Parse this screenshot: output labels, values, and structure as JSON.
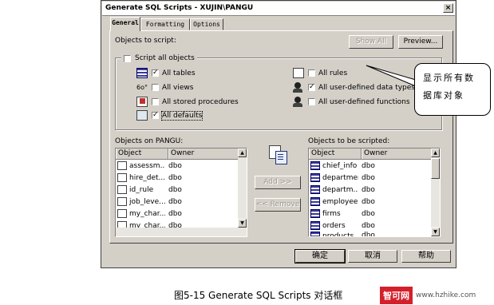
{
  "window": {
    "title": "Generate SQL Scripts - XUJIN\\PANGU",
    "close_label": "×"
  },
  "tabs": [
    {
      "label": "General"
    },
    {
      "label": "Formatting"
    },
    {
      "label": "Options"
    }
  ],
  "general": {
    "objects_to_script_label": "Objects to script:",
    "show_all_label": "Show All",
    "preview_label": "Preview...",
    "script_all_objects_label": "Script all objects",
    "options": [
      {
        "label": "All tables",
        "checked": true
      },
      {
        "label": "All views",
        "checked": false
      },
      {
        "label": "All stored procedures",
        "checked": false
      },
      {
        "label": "All defaults",
        "checked": true
      },
      {
        "label": "All rules",
        "checked": false
      },
      {
        "label": "All user-defined data types",
        "checked": true
      },
      {
        "label": "All user-defined functions",
        "checked": false
      }
    ],
    "objects_on_label": "Objects on PANGU:",
    "objects_to_be_scripted_label": "Objects to be scripted:",
    "columns": {
      "object": "Object",
      "owner": "Owner"
    },
    "left_list": [
      {
        "object": "assessm...",
        "owner": "dbo"
      },
      {
        "object": "hire_det...",
        "owner": "dbo"
      },
      {
        "object": "id_rule",
        "owner": "dbo"
      },
      {
        "object": "job_leve...",
        "owner": "dbo"
      },
      {
        "object": "my_char...",
        "owner": "dbo"
      },
      {
        "object": "my_char...",
        "owner": "dbo"
      }
    ],
    "right_list": [
      {
        "object": "chief_info",
        "owner": "dbo"
      },
      {
        "object": "department",
        "owner": "dbo"
      },
      {
        "object": "departm...",
        "owner": "dbo"
      },
      {
        "object": "employee",
        "owner": "dbo"
      },
      {
        "object": "firms",
        "owner": "dbo"
      },
      {
        "object": "orders",
        "owner": "dbo"
      },
      {
        "object": "products",
        "owner": "dbo"
      }
    ],
    "add_label": "Add >>",
    "remove_label": "<< Remove"
  },
  "footer": {
    "ok_label": "确定",
    "cancel_label": "取消",
    "help_label": "帮助"
  },
  "callout": {
    "line1": "显示所有数",
    "line2": "据库对象"
  },
  "caption": "图5-15  Generate SQL Scripts 对话框",
  "watermark": {
    "brand": "智可网",
    "url": "www.hzhike.com"
  },
  "colors": {
    "dialog_bg": "#d4d0c8",
    "table_icon": "#3a3a9a",
    "watermark_red": "#d4202a"
  }
}
